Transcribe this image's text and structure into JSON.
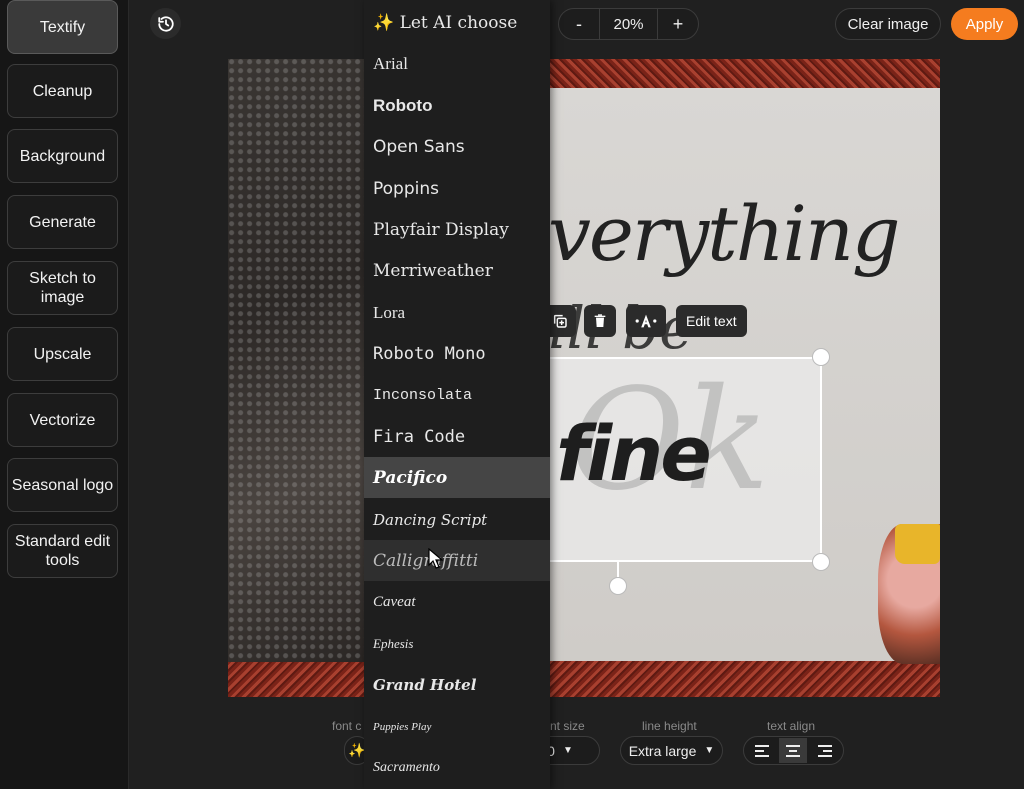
{
  "sidebar": {
    "items": [
      {
        "label": "Textify",
        "active": true
      },
      {
        "label": "Cleanup"
      },
      {
        "label": "Background"
      },
      {
        "label": "Generate"
      },
      {
        "label": "Sketch to image"
      },
      {
        "label": "Upscale"
      },
      {
        "label": "Vectorize"
      },
      {
        "label": "Seasonal logo"
      },
      {
        "label": "Standard edit tools"
      }
    ]
  },
  "topbar": {
    "history_icon": "history-icon",
    "zoom": {
      "minus": "-",
      "value": "20%",
      "plus": "+"
    },
    "clear_label": "Clear image",
    "apply_label": "Apply",
    "accent": "#f57c1f"
  },
  "canvas": {
    "heading_text": "verything",
    "subline_text": "ill be",
    "selected_text": "fine",
    "ghost_text": "Ok"
  },
  "text_toolbar": {
    "edit_label": "Edit text"
  },
  "controls": {
    "font_label": "font c",
    "size_label": "nt size",
    "size_value": "0",
    "line_height_label": "line height",
    "line_height_value": "Extra large",
    "text_align_label": "text align"
  },
  "font_menu": {
    "items": [
      "✨ Let AI choose",
      "Arial",
      "Roboto",
      "Open Sans",
      "Poppins",
      "Playfair Display",
      "Merriweather",
      "Lora",
      "Roboto Mono",
      "Inconsolata",
      "Fira Code",
      "Pacifico",
      "Dancing Script",
      "Calligraffitti",
      "Caveat",
      "Ephesis",
      "Grand Hotel",
      "Puppies Play",
      "Sacramento"
    ],
    "selected": "Pacifico",
    "hovered": "Calligraffitti"
  }
}
